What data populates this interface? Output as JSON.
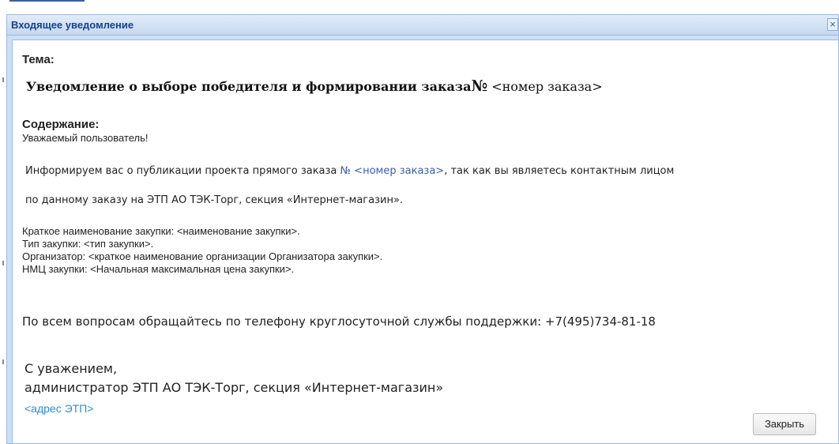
{
  "window": {
    "title": "Входящее уведомление",
    "close_icon_glyph": "×"
  },
  "message": {
    "subject_label": "Тема:",
    "subject_text": "Уведомление о выборе победителя и формировании заказа",
    "subject_number_sign": "№",
    "subject_placeholder": " <номер заказа>",
    "content_label": "Содержание:",
    "greeting": "Уважаемый пользователь!",
    "para1_before": "Информируем вас о публикации проекта прямого заказа ",
    "para1_link": "№ <номер заказа>",
    "para1_after": ", так как вы являетесь контактным лицом",
    "para1_line2": "по данному заказу  на ЭТП АО ТЭК-Торг, секция «Интернет-магазин».",
    "detail_name": "Краткое наименование закупки: <наименование закупки>.",
    "detail_type": "Тип закупки: <тип закупки>.",
    "detail_organizer": "Организатор: <краткое наименование организации Организатора закупки>.",
    "detail_price": "НМЦ закупки: <Начальная максимальная цена закупки>.",
    "support": "По всем вопросам обращайтесь по телефону круглосуточной службы поддержки: +7(495)734-81-18",
    "regards": "С уважением,",
    "signature": "администратор ЭТП АО ТЭК-Торг, секция «Интернет-магазин»",
    "address": "<адрес ЭТП>"
  },
  "buttons": {
    "close_label": "Закрыть"
  }
}
